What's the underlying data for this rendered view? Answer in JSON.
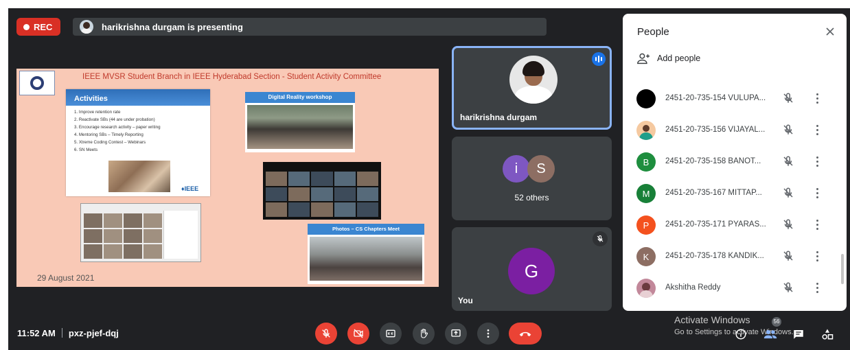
{
  "top": {
    "rec_label": "REC",
    "presenting_text": "harikrishna durgam is presenting"
  },
  "slide": {
    "title": "IEEE MVSR Student Branch in IEEE Hyderabad Section - Student Activity Committee",
    "activities_heading": "Activities",
    "activities": [
      "1. Improve retention rate",
      "2. Reactivate SBs (44 are under probation)",
      "3. Encourage research activity – paper writing",
      "4. Mentoring SBs – Timely Reporting",
      "5. Xtreme Coding Contest – Webinars",
      "6. SN Meets"
    ],
    "ieee_mark": "♦IEEE",
    "workshop_heading": "Digital Reality workshop",
    "chapters_heading": "Photos – CS Chapters Meet",
    "date": "29 August 2021"
  },
  "tiles": {
    "presenter_name": "harikrishna durgam",
    "others_initials": [
      "i",
      "S"
    ],
    "others_label": "52 others",
    "you_initial": "G",
    "you_label": "You"
  },
  "bottom": {
    "time": "11:52 AM",
    "meeting_code": "pxz-pjef-dqj",
    "participant_count": "56"
  },
  "watermark": {
    "line1": "Activate Windows",
    "line2": "Go to Settings to activate Windows."
  },
  "people_panel": {
    "title": "People",
    "add_people": "Add people",
    "participants": [
      {
        "name": "2451-20-735-154 VULUPA...",
        "initial": "",
        "color": "#000000"
      },
      {
        "name": "2451-20-735-156 VIJAYAL...",
        "initial": "",
        "color": "#f5c9a0"
      },
      {
        "name": "2451-20-735-158 BANOT...",
        "initial": "B",
        "color": "#1e8e3e"
      },
      {
        "name": "2451-20-735-167 MITTAP...",
        "initial": "M",
        "color": "#188038"
      },
      {
        "name": "2451-20-735-171 PYARAS...",
        "initial": "P",
        "color": "#f4511e"
      },
      {
        "name": "2451-20-735-178 KANDIK...",
        "initial": "K",
        "color": "#8d6e63"
      },
      {
        "name": "Akshitha Reddy",
        "initial": "",
        "color": "#c2889a"
      }
    ]
  }
}
